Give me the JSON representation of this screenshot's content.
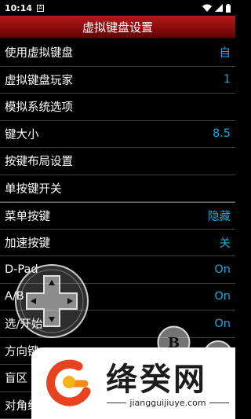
{
  "status": {
    "time": "10:14",
    "badge": "A"
  },
  "title": "虚拟键盘设置",
  "rows": [
    {
      "label": "使用虚拟键盘",
      "value": "自"
    },
    {
      "label": "虚拟键盘玩家",
      "value": "1"
    },
    {
      "label": "模拟系统选项",
      "value": ""
    },
    {
      "label": "键大小",
      "value": "8.5"
    },
    {
      "label": "按键布局设置",
      "value": ""
    },
    {
      "label": "单按键开关",
      "value": ""
    },
    {
      "label": "菜单按键",
      "value": "隐藏"
    },
    {
      "label": "加速按键",
      "value": "关"
    },
    {
      "label": "D-Pad",
      "value": "On"
    },
    {
      "label": "A/B",
      "value": "On"
    },
    {
      "label": "选/开始",
      "value": "On"
    },
    {
      "label": "方向键",
      "value": ""
    },
    {
      "label": "盲区",
      "value": ""
    },
    {
      "label": "对角线",
      "value": ""
    }
  ],
  "controls": {
    "b_label": "B"
  },
  "watermark": {
    "brand": "绛癸网",
    "url": "jiangguijiuye.com"
  },
  "colors": {
    "accent": "#19a8e0",
    "title_bar": "#8a0d0d"
  }
}
